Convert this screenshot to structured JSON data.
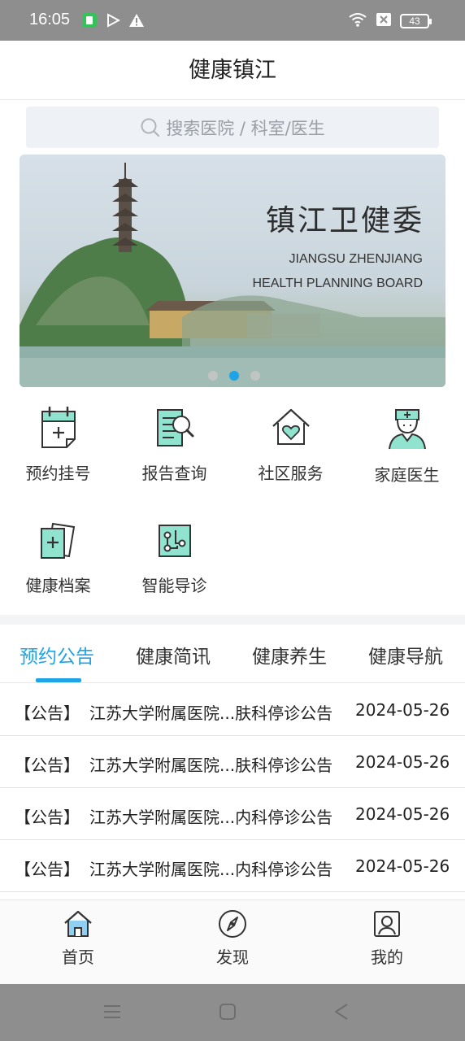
{
  "status_bar": {
    "time": "16:05",
    "battery": "43",
    "icons": [
      "app-notification-icon",
      "play-icon",
      "warning-icon",
      "wifi-icon",
      "no-sim-icon",
      "battery-icon"
    ]
  },
  "header": {
    "title": "健康镇江"
  },
  "search": {
    "placeholder": "搜索医院 / 科室/医生"
  },
  "banner": {
    "title": "镇江卫健委",
    "subtitle_line1": "JIANGSU ZHENJIANG",
    "subtitle_line2": "HEALTH PLANNING BOARD",
    "active_slide": 2,
    "slide_count": 3
  },
  "quick_services": [
    {
      "label": "预约挂号",
      "icon": "calendar-plus-icon"
    },
    {
      "label": "报告查询",
      "icon": "report-search-icon"
    },
    {
      "label": "社区服务",
      "icon": "house-heart-icon"
    },
    {
      "label": "家庭医生",
      "icon": "doctor-icon"
    },
    {
      "label": "健康档案",
      "icon": "health-record-icon"
    },
    {
      "label": "智能导诊",
      "icon": "smart-guide-icon"
    }
  ],
  "tabs": [
    {
      "label": "预约公告",
      "active": true
    },
    {
      "label": "健康简讯",
      "active": false
    },
    {
      "label": "健康养生",
      "active": false
    },
    {
      "label": "健康导航",
      "active": false
    }
  ],
  "news": [
    {
      "tag": "【公告】",
      "title": "江苏大学附属医院...肤科停诊公告",
      "date": "2024-05-26"
    },
    {
      "tag": "【公告】",
      "title": "江苏大学附属医院...肤科停诊公告",
      "date": "2024-05-26"
    },
    {
      "tag": "【公告】",
      "title": "江苏大学附属医院...内科停诊公告",
      "date": "2024-05-26"
    },
    {
      "tag": "【公告】",
      "title": "江苏大学附属医院...内科停诊公告",
      "date": "2024-05-26"
    }
  ],
  "bottom_nav": [
    {
      "label": "首页",
      "icon": "home-icon"
    },
    {
      "label": "发现",
      "icon": "compass-icon"
    },
    {
      "label": "我的",
      "icon": "profile-icon"
    }
  ],
  "colors": {
    "accent": "#1ea4e6",
    "icon_fill": "#8fe3cf"
  }
}
